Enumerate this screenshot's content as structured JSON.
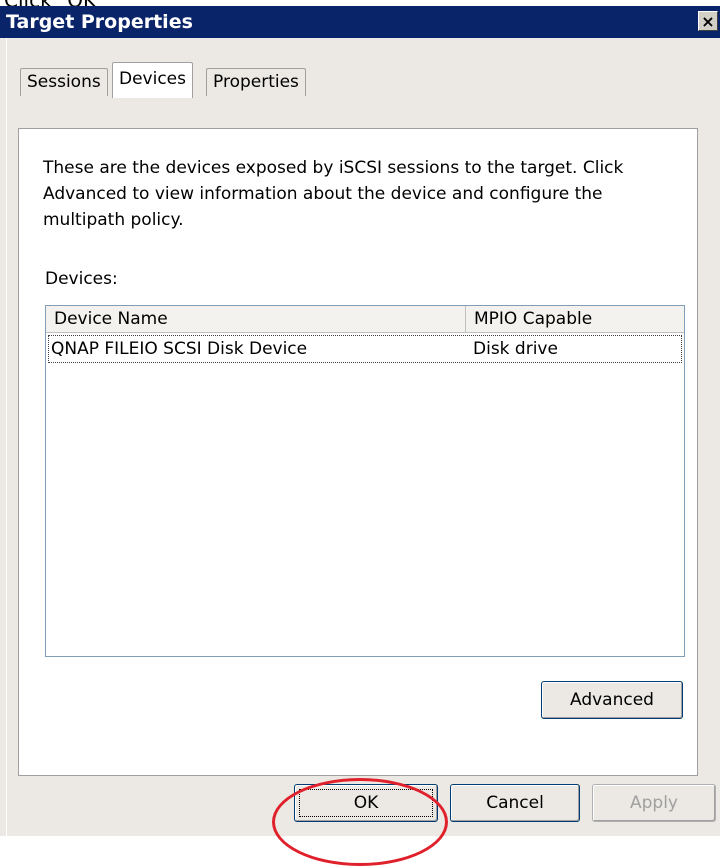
{
  "caption": "Click \"OK\"",
  "window": {
    "title": "Target Properties",
    "close_glyph": "×"
  },
  "tabs": [
    {
      "label": "Sessions",
      "active": false
    },
    {
      "label": "Devices",
      "active": true
    },
    {
      "label": "Properties",
      "active": false
    }
  ],
  "panel": {
    "description": "These are the devices exposed by iSCSI sessions to the target. Click Advanced to view information about the device and configure the multipath policy.",
    "devices_label": "Devices:",
    "columns": [
      "Device Name",
      "MPIO Capable"
    ],
    "rows": [
      {
        "device_name": "QNAP FILEIO SCSI Disk Device",
        "mpio_capable": "Disk drive"
      }
    ],
    "advanced_label": "Advanced"
  },
  "footer": {
    "ok_label": "OK",
    "cancel_label": "Cancel",
    "apply_label": "Apply"
  },
  "colors": {
    "titlebar": "#0a246a",
    "dialog_bg": "#ece9e4",
    "highlight_ring": "#e0202a"
  }
}
